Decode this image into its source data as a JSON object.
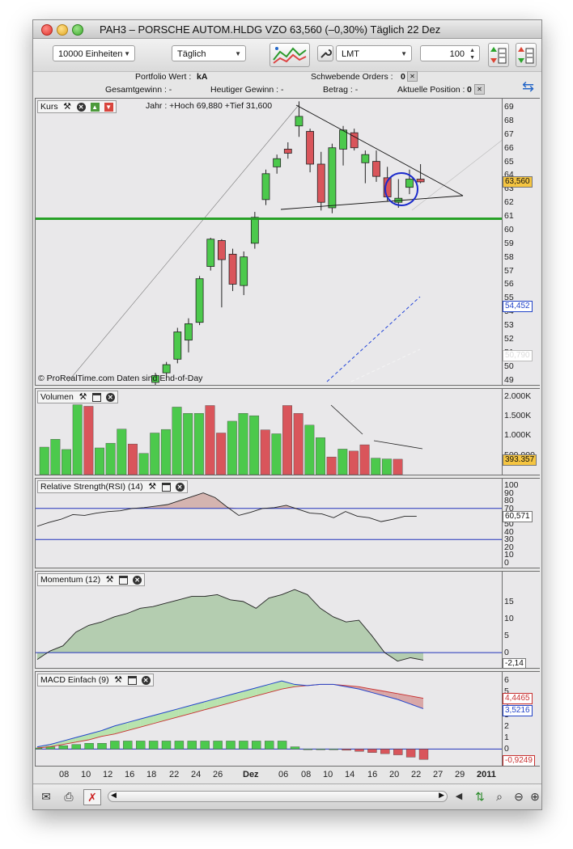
{
  "window": {
    "title": "PAH3 – PORSCHE AUTOM.HLDG VZO     63,560 (–0,30%)    Täglich  22 Dez"
  },
  "toolbar": {
    "units": "10000 Einheiten",
    "period": "Täglich",
    "order_type": "LMT",
    "quantity": "100"
  },
  "info": {
    "portfolio_label": "Portfolio Wert :",
    "portfolio_value": "kA",
    "pending_label": "Schwebende Orders :",
    "pending_value": "0",
    "gain_total": "Gesamtgewinn : -",
    "gain_today": "Heutiger Gewinn : -",
    "amount": "Betrag : -",
    "position_label": "Aktuelle Position :",
    "position_value": "0"
  },
  "colors": {
    "up": "#4cc94c",
    "down": "#d9555b",
    "support": "#27a127",
    "rsi_fill": "#d4b4b0",
    "mom_fill": "#b4cdb0"
  },
  "price_panel": {
    "title": "Kurs",
    "year_info": "Jahr : +Hoch 69,880 +Tief 31,600",
    "footer": "© ProRealTime.com     Daten sind End-of-Day",
    "current": "63,560",
    "blue_tag": "54,452",
    "gray_tag": "50,790",
    "ticks": [
      "69",
      "68",
      "67",
      "66",
      "65",
      "64",
      "63",
      "62",
      "61",
      "60",
      "59",
      "58",
      "57",
      "56",
      "55",
      "54",
      "53",
      "52",
      "51",
      "50",
      "49"
    ],
    "support_level": 60.8,
    "candles": [
      {
        "o": 48.8,
        "h": 49.5,
        "l": 48.6,
        "c": 49.3
      },
      {
        "o": 49.5,
        "h": 50.3,
        "l": 49.2,
        "c": 50.1
      },
      {
        "o": 50.5,
        "h": 52.8,
        "l": 50.2,
        "c": 52.5
      },
      {
        "o": 51.9,
        "h": 53.5,
        "l": 51.0,
        "c": 53.1
      },
      {
        "o": 53.2,
        "h": 56.6,
        "l": 53.0,
        "c": 56.4
      },
      {
        "o": 57.3,
        "h": 59.4,
        "l": 57.0,
        "c": 59.3
      },
      {
        "o": 59.2,
        "h": 59.3,
        "l": 54.3,
        "c": 57.8
      },
      {
        "o": 58.2,
        "h": 58.6,
        "l": 55.5,
        "c": 56.0
      },
      {
        "o": 55.9,
        "h": 58.4,
        "l": 55.2,
        "c": 58.0
      },
      {
        "o": 59.0,
        "h": 61.3,
        "l": 58.6,
        "c": 60.9
      },
      {
        "o": 62.2,
        "h": 64.4,
        "l": 61.8,
        "c": 64.1
      },
      {
        "o": 64.6,
        "h": 65.5,
        "l": 64.1,
        "c": 65.2
      },
      {
        "o": 65.9,
        "h": 66.4,
        "l": 65.2,
        "c": 65.6
      },
      {
        "o": 67.6,
        "h": 69.4,
        "l": 66.8,
        "c": 68.3
      },
      {
        "o": 67.2,
        "h": 67.4,
        "l": 64.2,
        "c": 64.8
      },
      {
        "o": 64.8,
        "h": 65.7,
        "l": 61.4,
        "c": 62.0
      },
      {
        "o": 61.6,
        "h": 66.3,
        "l": 61.2,
        "c": 66.0
      },
      {
        "o": 65.9,
        "h": 67.6,
        "l": 64.7,
        "c": 67.3
      },
      {
        "o": 67.1,
        "h": 67.4,
        "l": 65.8,
        "c": 66.0
      },
      {
        "o": 64.9,
        "h": 65.8,
        "l": 63.4,
        "c": 65.5
      },
      {
        "o": 65.0,
        "h": 65.8,
        "l": 63.5,
        "c": 63.9
      },
      {
        "o": 63.8,
        "h": 64.6,
        "l": 62.1,
        "c": 62.4
      },
      {
        "o": 62.0,
        "h": 63.7,
        "l": 61.6,
        "c": 62.3
      },
      {
        "o": 63.1,
        "h": 64.4,
        "l": 62.6,
        "c": 63.7
      },
      {
        "o": 63.7,
        "h": 64.8,
        "l": 63.4,
        "c": 63.5
      }
    ]
  },
  "volume_panel": {
    "title": "Volumen",
    "current": "393.357",
    "ticks": [
      "2.000K",
      "1.500K",
      "1.000K",
      "500.000"
    ],
    "bars": [
      {
        "v": 700,
        "up": true
      },
      {
        "v": 900,
        "up": true
      },
      {
        "v": 640,
        "up": true
      },
      {
        "v": 1780,
        "up": true
      },
      {
        "v": 1740,
        "up": false
      },
      {
        "v": 680,
        "up": true
      },
      {
        "v": 800,
        "up": true
      },
      {
        "v": 1160,
        "up": true
      },
      {
        "v": 780,
        "up": false
      },
      {
        "v": 540,
        "up": true
      },
      {
        "v": 1060,
        "up": true
      },
      {
        "v": 1150,
        "up": true
      },
      {
        "v": 1720,
        "up": true
      },
      {
        "v": 1560,
        "up": true
      },
      {
        "v": 1560,
        "up": true
      },
      {
        "v": 1760,
        "up": false
      },
      {
        "v": 1060,
        "up": false
      },
      {
        "v": 1360,
        "up": true
      },
      {
        "v": 1560,
        "up": true
      },
      {
        "v": 1500,
        "up": true
      },
      {
        "v": 1140,
        "up": false
      },
      {
        "v": 1040,
        "up": true
      },
      {
        "v": 1760,
        "up": false
      },
      {
        "v": 1560,
        "up": false
      },
      {
        "v": 1260,
        "up": true
      },
      {
        "v": 940,
        "up": true
      },
      {
        "v": 450,
        "up": false
      },
      {
        "v": 650,
        "up": true
      },
      {
        "v": 600,
        "up": false
      },
      {
        "v": 760,
        "up": false
      },
      {
        "v": 420,
        "up": true
      },
      {
        "v": 400,
        "up": true
      },
      {
        "v": 393,
        "up": false
      }
    ]
  },
  "rsi_panel": {
    "title": "Relative Strength(RSI) (14)",
    "current": "60,571",
    "ticks": [
      "100",
      "90",
      "80",
      "70",
      "60",
      "50",
      "40",
      "30",
      "20",
      "10",
      "0"
    ],
    "upper": 70,
    "lower": 30,
    "values": [
      47,
      52,
      56,
      62,
      61,
      64,
      66,
      67,
      70,
      71,
      73,
      75,
      80,
      85,
      90,
      84,
      72,
      61,
      65,
      70,
      71,
      74,
      69,
      64,
      63,
      58,
      66,
      60,
      58,
      53,
      56,
      60,
      60
    ]
  },
  "momentum_panel": {
    "title": "Momentum (12)",
    "current": "-2,14",
    "ticks": [
      "15",
      "10",
      "5",
      "0"
    ],
    "values": [
      -2,
      0.5,
      2,
      6,
      8,
      9,
      10.5,
      11.5,
      13,
      13.5,
      14.5,
      15.5,
      16.5,
      16.5,
      17,
      15.5,
      15,
      13,
      16,
      17,
      18.5,
      17,
      13,
      10.5,
      9,
      9.5,
      5,
      0,
      -2.5,
      -1.5,
      -2.2
    ]
  },
  "macd_panel": {
    "title": "MACD Einfach (9)",
    "signal_value": "4,4465",
    "macd_value": "3,5216",
    "hist_value": "-0,9249",
    "ticks": [
      "6",
      "5",
      "4",
      "3",
      "2",
      "1",
      "0"
    ],
    "macd": [
      0.2,
      0.4,
      0.7,
      1.0,
      1.3,
      1.6,
      2.0,
      2.3,
      2.6,
      2.9,
      3.2,
      3.5,
      3.8,
      4.1,
      4.4,
      4.7,
      5.0,
      5.3,
      5.6,
      5.9,
      5.6,
      5.5,
      5.6,
      5.6,
      5.4,
      5.2,
      4.9,
      4.6,
      4.3,
      3.9,
      3.5
    ],
    "signal": [
      0.1,
      0.2,
      0.4,
      0.6,
      0.8,
      1.1,
      1.3,
      1.6,
      1.9,
      2.2,
      2.5,
      2.8,
      3.1,
      3.4,
      3.7,
      4.0,
      4.3,
      4.6,
      4.9,
      5.2,
      5.4,
      5.5,
      5.6,
      5.6,
      5.5,
      5.4,
      5.2,
      5.0,
      4.8,
      4.6,
      4.4
    ],
    "hist": [
      0.1,
      0.2,
      0.3,
      0.4,
      0.5,
      0.5,
      0.7,
      0.7,
      0.7,
      0.7,
      0.7,
      0.7,
      0.7,
      0.7,
      0.7,
      0.7,
      0.7,
      0.7,
      0.7,
      0.7,
      0.2,
      0,
      0,
      0,
      -0.1,
      -0.2,
      -0.3,
      -0.4,
      -0.5,
      -0.7,
      -0.9
    ]
  },
  "x_labels": [
    "08",
    "10",
    "12",
    "16",
    "18",
    "22",
    "24",
    "26",
    "Dez",
    "06",
    "08",
    "10",
    "14",
    "16",
    "20",
    "22",
    "27",
    "29",
    "2011"
  ]
}
